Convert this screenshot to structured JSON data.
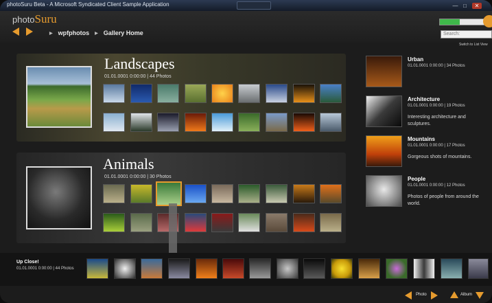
{
  "window": {
    "title": "photoSuru Beta - A Microsoft Syndicated Client Sample Application"
  },
  "colors": {
    "accent": "#e69b2e",
    "progress": "#3fb84a"
  },
  "header": {
    "logo_part1": "photo",
    "logo_part2": "Suru",
    "breadcrumb": [
      "wpfphotos",
      "Gallery Home"
    ],
    "search_placeholder": "Search:",
    "switch_link": "Switch to List View",
    "progress_fraction": 0.45
  },
  "albums": [
    {
      "title": "Landscapes",
      "meta": "01.01.0001 0:00:00 | 44 Photos"
    },
    {
      "title": "Animals",
      "meta": "01.01.0001 0:00:00 | 30 Photos"
    }
  ],
  "sidebar": [
    {
      "title": "Urban",
      "meta": "01.01.0001 0:00:00 | 34 Photos",
      "desc": ""
    },
    {
      "title": "Architecture",
      "meta": "01.01.0001 0:00:00 | 19 Photos",
      "desc": "Interesting architecture and sculptures."
    },
    {
      "title": "Mountains",
      "meta": "01.01.0001 0:00:00 | 17 Photos",
      "desc": "Gorgeous shots of mountains."
    },
    {
      "title": "People",
      "meta": "01.01.0001 0:00:00 | 12 Photos",
      "desc": "Photos of people from around the world."
    }
  ],
  "filmstrip": {
    "title": "Up Close!",
    "meta": "01.01.0001 0:00:00 | 44 Photos"
  },
  "bottom_nav": {
    "photo_label": "Photo",
    "album_label": "Album"
  }
}
